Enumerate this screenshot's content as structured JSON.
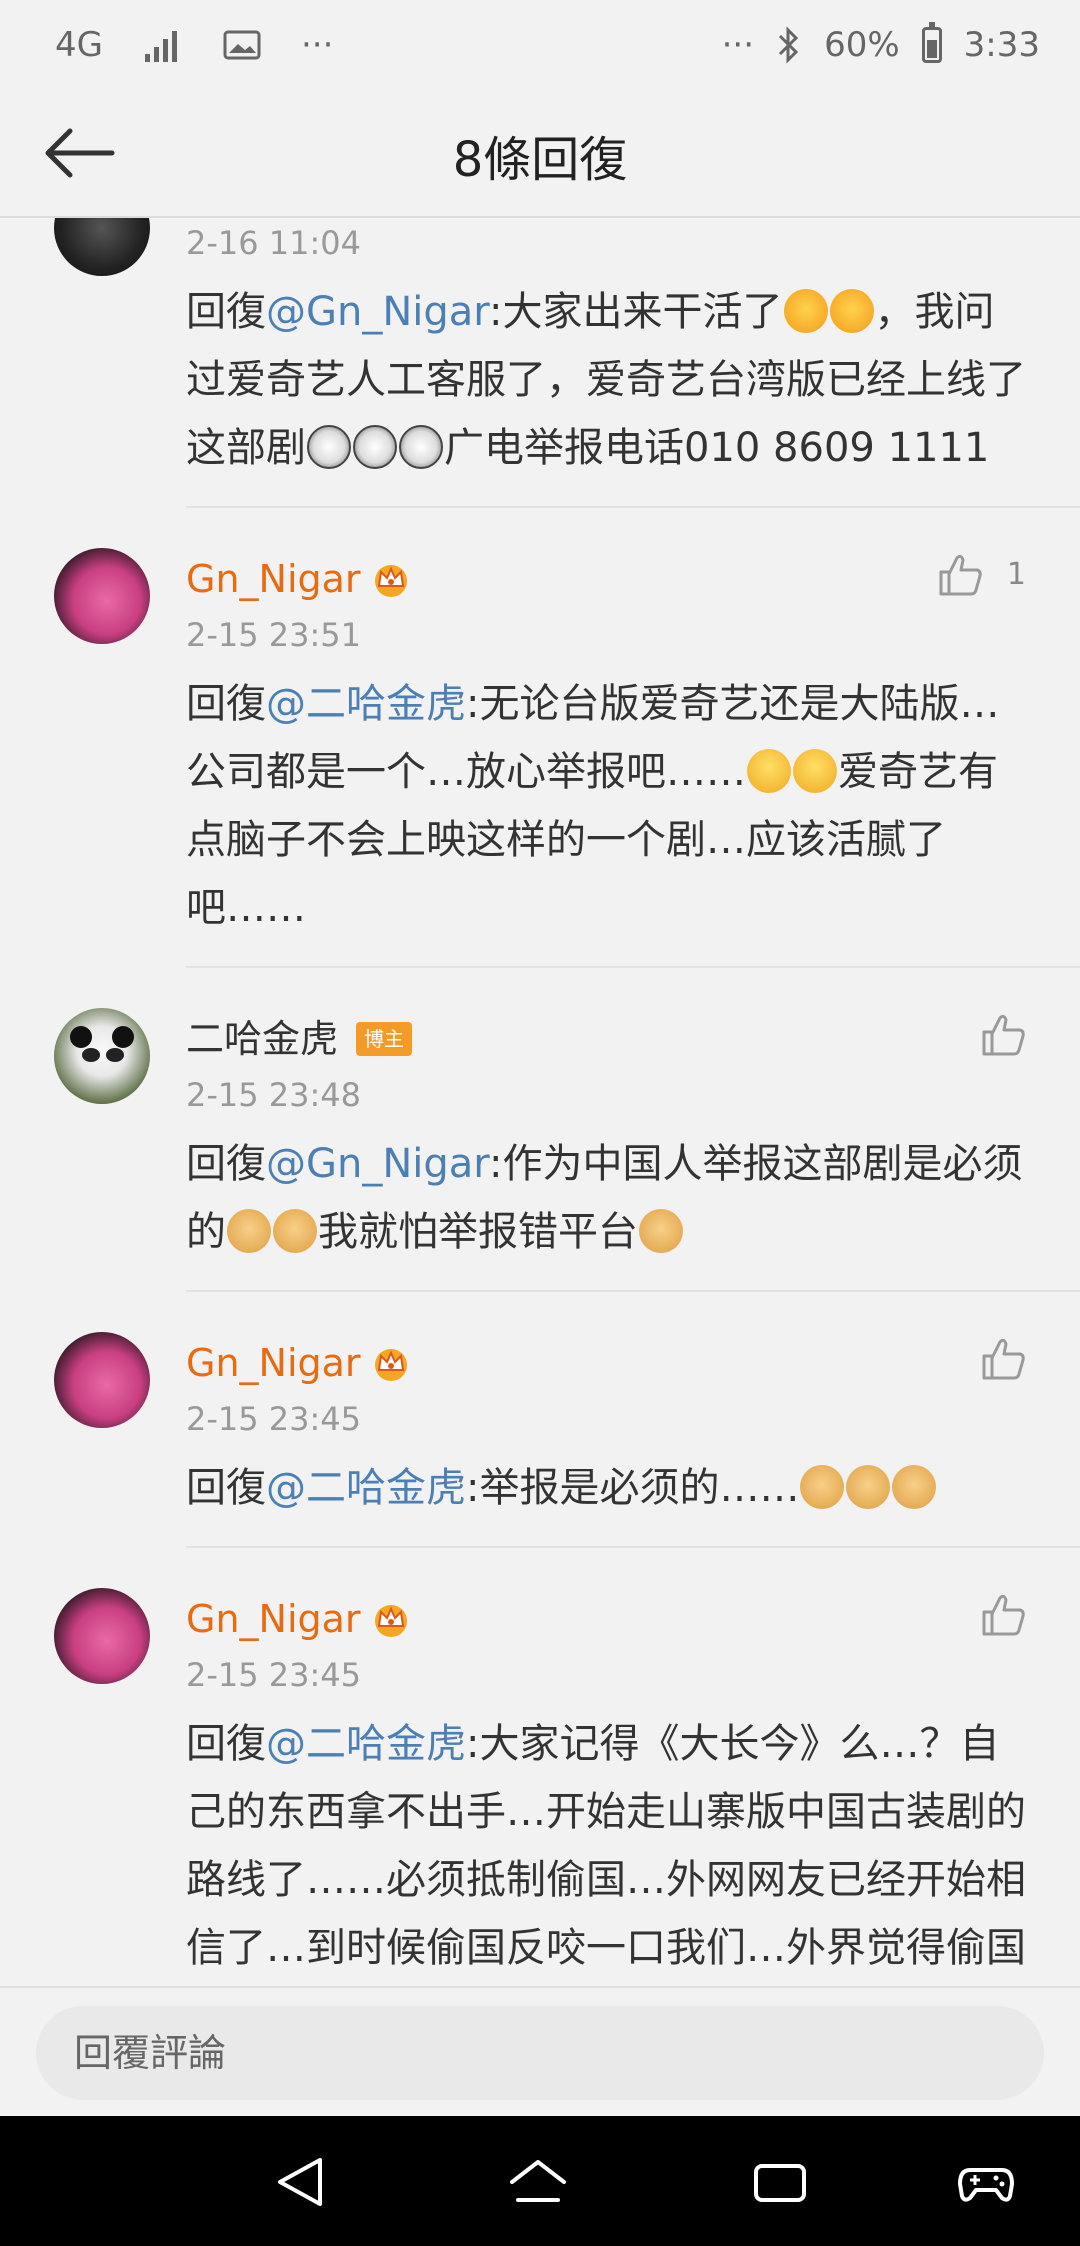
{
  "status_bar": {
    "network": "4G",
    "battery": "60%",
    "time": "3:33",
    "overflow_left": "···",
    "overflow_right": "···",
    "battery_level": 0.6
  },
  "header": {
    "title": "8條回復"
  },
  "comments": [
    {
      "time": "2-16 11:04",
      "prefix": "回復",
      "mention": "@Gn_Nigar",
      "text_before": ":大家出来干活了",
      "text_after": "，我问过爱奇艺人工客服了，爱奇艺台湾版已经上线了这部剧",
      "text_end": "广电举报电话010 8609 1111"
    },
    {
      "name": "Gn_Nigar",
      "time": "2-15 23:51",
      "likes": "1",
      "prefix": "回復",
      "mention": "@二哈金虎",
      "text_before": ":无论台版爱奇艺还是大陆版…公司都是一个…放心举报吧……",
      "text_after": "爱奇艺有点脑子不会上映这样的一个剧…应该活腻了吧……"
    },
    {
      "name": "二哈金虎",
      "badge": "博主",
      "time": "2-15 23:48",
      "prefix": "回復",
      "mention": "@Gn_Nigar",
      "text_before": ":作为中国人举报这部剧是必须的",
      "text_mid": "我就怕举报错平台"
    },
    {
      "name": "Gn_Nigar",
      "time": "2-15 23:45",
      "prefix": "回復",
      "mention": "@二哈金虎",
      "text_before": ":举报是必须的……"
    },
    {
      "name": "Gn_Nigar",
      "time": "2-15 23:45",
      "prefix": "回復",
      "mention": "@二哈金虎",
      "text_before": ":大家记得《大长今》么…？自己的东西拿不出手…开始走山寨版中国古装剧的路线了……必须抵制偷国…外网网友已经开始相信了…到时候偷国反咬一口我们…外界觉得偷国在自保..我们施暴"
    }
  ],
  "reply_input": {
    "placeholder": "回覆評論"
  },
  "colors": {
    "accent_name": "#e86b12",
    "mention": "#4c7fb3",
    "background": "#f2f2f2"
  }
}
